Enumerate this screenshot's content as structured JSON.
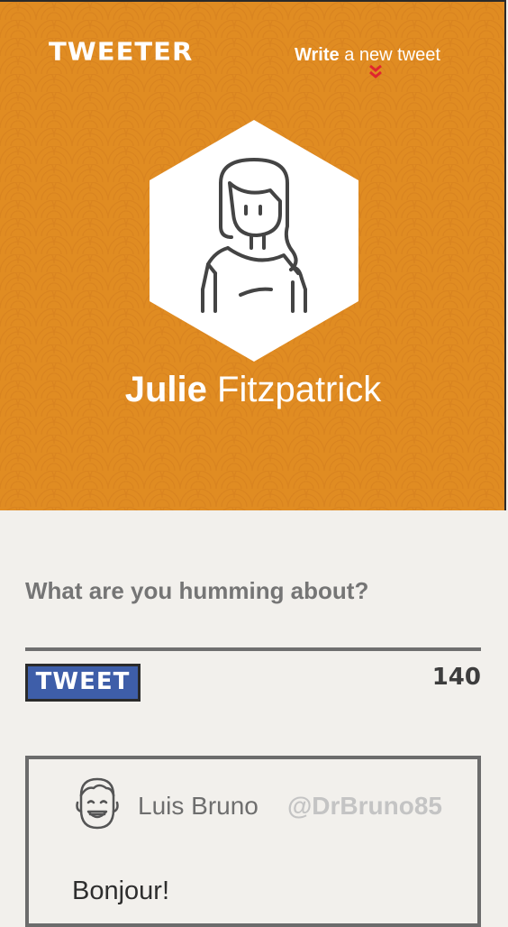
{
  "header": {
    "logo": "TWEETER",
    "write_bold": "Write",
    "write_rest": " a new tweet"
  },
  "profile": {
    "first_name": "Julie",
    "last_name": "Fitzpatrick",
    "avatar_icon": "woman-avatar-icon"
  },
  "composer": {
    "placeholder": "What are you humming about?",
    "button_label": "TWEET",
    "char_count": "140"
  },
  "tweets": [
    {
      "name": "Luis Bruno",
      "handle": "@DrBruno85",
      "text": "Bonjour!",
      "avatar_icon": "man-avatar-icon"
    }
  ],
  "colors": {
    "hero_bg": "#e08c22",
    "button_bg": "#3e5ea9",
    "chevron": "#e0262e",
    "page_bg": "#f2f0ec"
  }
}
